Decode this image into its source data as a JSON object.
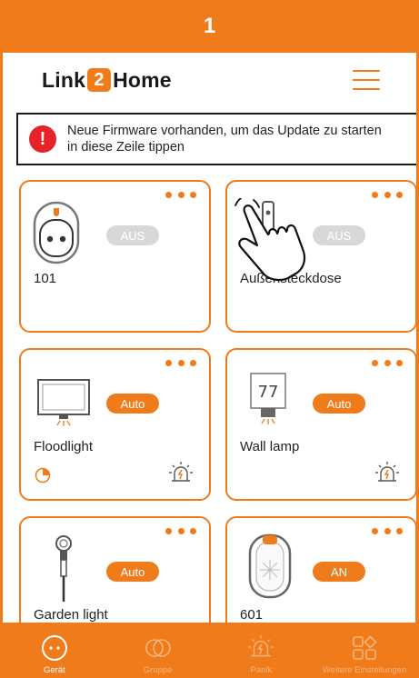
{
  "step": {
    "number": "1"
  },
  "app": {
    "logo_prefix": "Link",
    "logo_digit": "2",
    "logo_suffix": "Home"
  },
  "banner": {
    "line1": "Neue Firmware vorhanden, um das Update zu starten",
    "line2": "in diese Zeile tippen",
    "icon_text": "!"
  },
  "devices": [
    {
      "name": "101",
      "status": "AUS",
      "status_on": false,
      "icon": "socket-icon"
    },
    {
      "name": "Außensteckdose",
      "status": "AUS",
      "status_on": false,
      "icon": "outdoor-plug-icon"
    },
    {
      "name": "Floodlight",
      "status": "Auto",
      "status_on": true,
      "icon": "floodlight-icon"
    },
    {
      "name": "Wall lamp",
      "status": "Auto",
      "status_on": true,
      "icon": "wall-lamp-icon",
      "wall_lamp_number": "77"
    },
    {
      "name": "Garden light",
      "status": "Auto",
      "status_on": true,
      "icon": "garden-light-icon"
    },
    {
      "name": "601",
      "status": "AN",
      "status_on": true,
      "icon": "light-sensor-icon"
    }
  ],
  "tabs": [
    {
      "label": "Gerät",
      "icon": "device-icon",
      "active": true
    },
    {
      "label": "Gruppe",
      "icon": "group-icon",
      "active": false
    },
    {
      "label": "Panik",
      "icon": "panic-icon",
      "active": false
    },
    {
      "label": "Weitere Einstellungen",
      "icon": "settings-icon",
      "active": false
    }
  ],
  "colors": {
    "accent": "#f07b1a",
    "warning": "#e6232a",
    "pill_off": "#d8d8d8"
  }
}
